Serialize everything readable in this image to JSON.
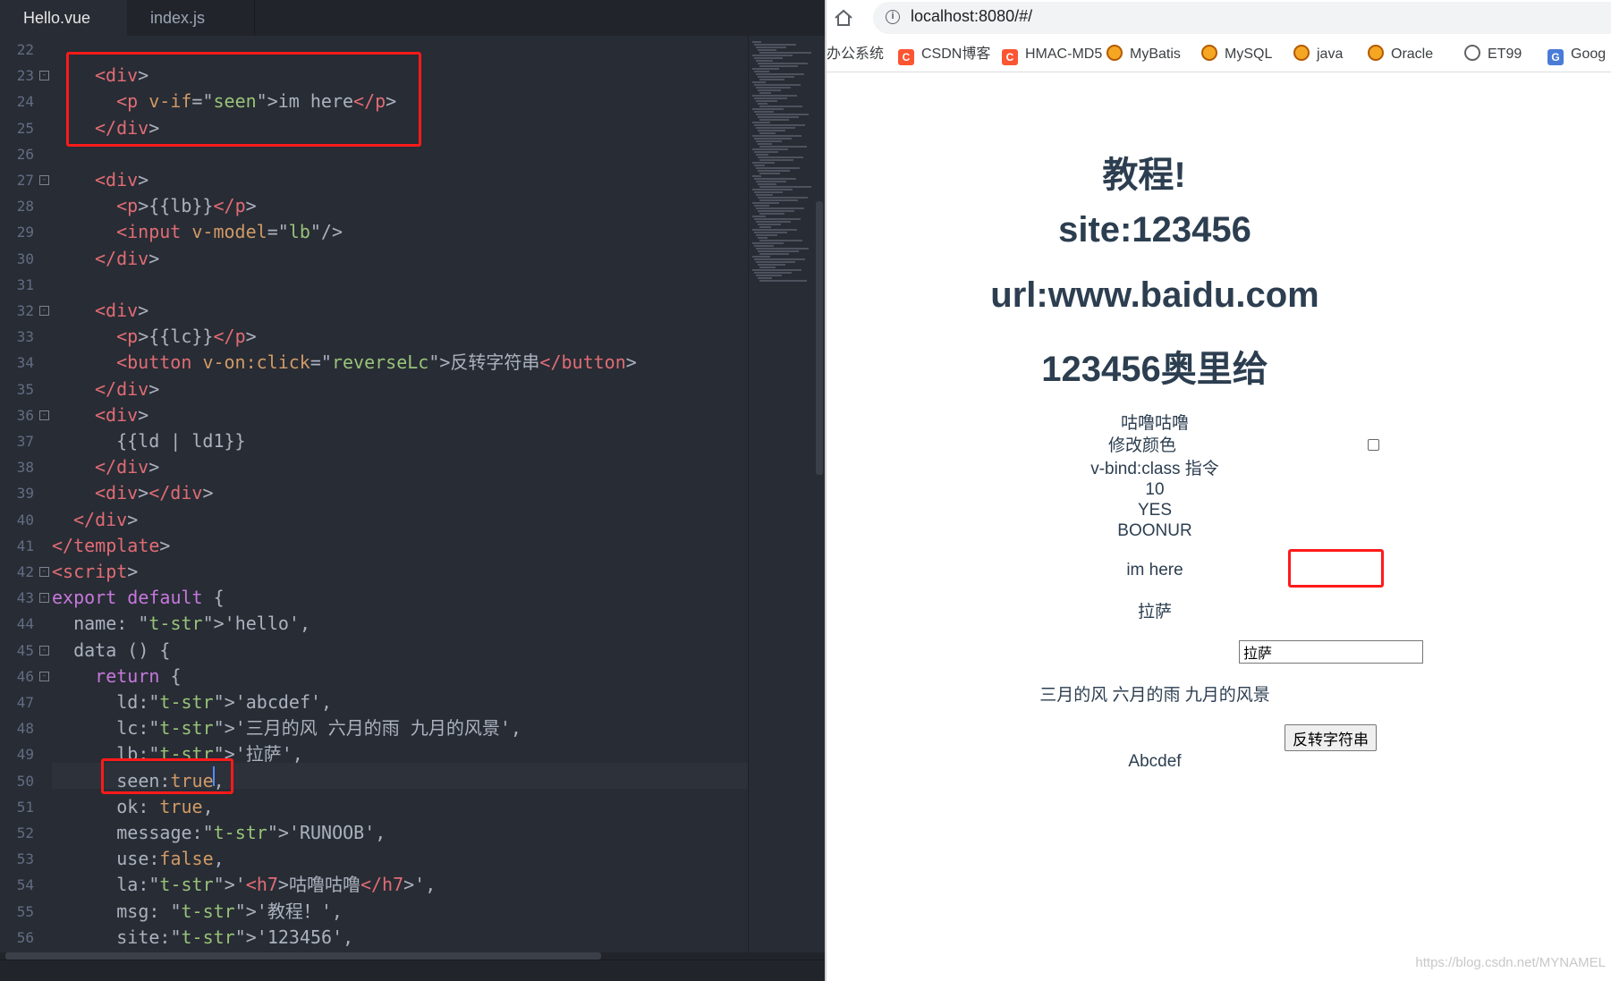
{
  "editor": {
    "tabs": [
      {
        "label": "Hello.vue"
      },
      {
        "label": "index.js"
      }
    ],
    "line_numbers": [
      "22",
      "23",
      "24",
      "25",
      "26",
      "27",
      "28",
      "29",
      "30",
      "31",
      "32",
      "33",
      "34",
      "35",
      "36",
      "37",
      "38",
      "39",
      "40",
      "41",
      "42",
      "43",
      "44",
      "45",
      "46",
      "47",
      "48",
      "49",
      "50",
      "51",
      "52",
      "53",
      "54",
      "55",
      "56"
    ],
    "code_lines": [
      "",
      "<div>",
      "  <p v-if=\"seen\">im here</p>",
      "</div>",
      "",
      "<div>",
      "  <p>{{lb}}</p>",
      "  <input v-model=\"lb\"/>",
      "</div>",
      "",
      "<div>",
      "  <p>{{lc}}</p>",
      "  <button v-on:click=\"reverseLc\">反转字符串</button>",
      "</div>",
      "<div>",
      "  {{ld | ld1}}",
      "</div>",
      "<div></div>",
      "</div>",
      "</template>",
      "<script>",
      "export default {",
      "  name: 'hello',",
      "  data () {",
      "    return {",
      "      ld:'abcdef',",
      "      lc:'三月的风 六月的雨 九月的风景',",
      "      lb:'拉萨',",
      "      seen:true,",
      "      ok: true,",
      "      message:'RUNOOB',",
      "      use:false,",
      "      la:'<h7>咕噜咕噜</h7>',",
      "      msg: '教程！',",
      "      site:'123456',"
    ]
  },
  "browser": {
    "url": "localhost:8080/#/",
    "bookmarks": [
      {
        "label": "办公系统",
        "icon": "none"
      },
      {
        "label": "CSDN博客",
        "icon": "csdn-icon"
      },
      {
        "label": "HMAC-MD5",
        "icon": "csdn-icon"
      },
      {
        "label": "MyBatis",
        "icon": "bee-icon"
      },
      {
        "label": "MySQL",
        "icon": "bee-icon"
      },
      {
        "label": "java",
        "icon": "bee-icon"
      },
      {
        "label": "Oracle",
        "icon": "bee-icon"
      },
      {
        "label": "ET99",
        "icon": "globe-icon"
      },
      {
        "label": "Goog",
        "icon": "translate-icon"
      }
    ],
    "page": {
      "heading_msg": "教程!",
      "heading_site": "site:123456",
      "heading_url": "url:www.baidu.com",
      "heading_combined": "123456奥里给",
      "text_gulu": "咕噜咕噜",
      "text_change_color": "修改颜色",
      "text_vbind": "v-bind:class 指令",
      "text_10": "10",
      "text_yes": "YES",
      "text_boonur": "BOONUR",
      "text_im_here": "im here",
      "text_lb": "拉萨",
      "input_value": "拉萨",
      "text_lc": "三月的风 六月的雨 九月的风景",
      "button_reverse": "反转字符串",
      "text_ld": "Abcdef"
    },
    "watermark": "https://blog.csdn.net/MYNAMEL"
  },
  "colors": {
    "annotation_red": "#ff1a1a",
    "editor_bg": "#282c34",
    "vue_text": "#2c3e50"
  }
}
